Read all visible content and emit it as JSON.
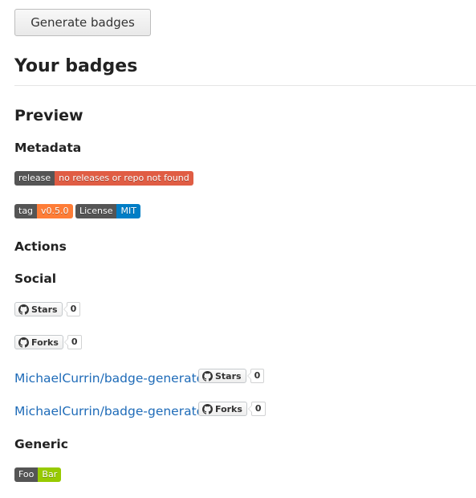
{
  "toolbar": {
    "generate_label": "Generate badges"
  },
  "headings": {
    "your_badges": "Your badges",
    "preview": "Preview",
    "metadata": "Metadata",
    "actions": "Actions",
    "social": "Social",
    "generic": "Generic"
  },
  "badges": {
    "release": {
      "label": "release",
      "message": "no releases or repo not found",
      "label_color": "#555555",
      "message_color": "#e05d44"
    },
    "tag": {
      "label": "tag",
      "message": "v0.5.0",
      "label_color": "#555555",
      "message_color": "#fe7d37"
    },
    "license": {
      "label": "License",
      "message": "MIT",
      "label_color": "#555555",
      "message_color": "#007ec6"
    },
    "generic": {
      "label": "Foo",
      "message": "Bar",
      "label_color": "#555555",
      "message_color": "#97ca00"
    }
  },
  "social": {
    "stars_label": "Stars",
    "stars_count": "0",
    "forks_label": "Forks",
    "forks_count": "0",
    "repo_link_text": "MichaelCurrin/badge-generator",
    "icon": "github-icon"
  }
}
